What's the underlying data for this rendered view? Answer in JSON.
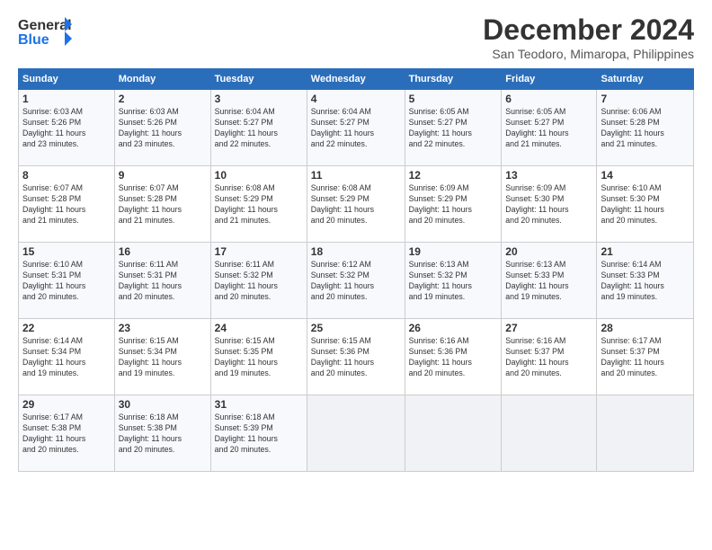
{
  "header": {
    "logo_line1": "General",
    "logo_line2": "Blue",
    "month": "December 2024",
    "location": "San Teodoro, Mimaropa, Philippines"
  },
  "weekdays": [
    "Sunday",
    "Monday",
    "Tuesday",
    "Wednesday",
    "Thursday",
    "Friday",
    "Saturday"
  ],
  "weeks": [
    [
      {
        "day": "1",
        "info": "Sunrise: 6:03 AM\nSunset: 5:26 PM\nDaylight: 11 hours\nand 23 minutes."
      },
      {
        "day": "2",
        "info": "Sunrise: 6:03 AM\nSunset: 5:26 PM\nDaylight: 11 hours\nand 23 minutes."
      },
      {
        "day": "3",
        "info": "Sunrise: 6:04 AM\nSunset: 5:27 PM\nDaylight: 11 hours\nand 22 minutes."
      },
      {
        "day": "4",
        "info": "Sunrise: 6:04 AM\nSunset: 5:27 PM\nDaylight: 11 hours\nand 22 minutes."
      },
      {
        "day": "5",
        "info": "Sunrise: 6:05 AM\nSunset: 5:27 PM\nDaylight: 11 hours\nand 22 minutes."
      },
      {
        "day": "6",
        "info": "Sunrise: 6:05 AM\nSunset: 5:27 PM\nDaylight: 11 hours\nand 21 minutes."
      },
      {
        "day": "7",
        "info": "Sunrise: 6:06 AM\nSunset: 5:28 PM\nDaylight: 11 hours\nand 21 minutes."
      }
    ],
    [
      {
        "day": "8",
        "info": "Sunrise: 6:07 AM\nSunset: 5:28 PM\nDaylight: 11 hours\nand 21 minutes."
      },
      {
        "day": "9",
        "info": "Sunrise: 6:07 AM\nSunset: 5:28 PM\nDaylight: 11 hours\nand 21 minutes."
      },
      {
        "day": "10",
        "info": "Sunrise: 6:08 AM\nSunset: 5:29 PM\nDaylight: 11 hours\nand 21 minutes."
      },
      {
        "day": "11",
        "info": "Sunrise: 6:08 AM\nSunset: 5:29 PM\nDaylight: 11 hours\nand 20 minutes."
      },
      {
        "day": "12",
        "info": "Sunrise: 6:09 AM\nSunset: 5:29 PM\nDaylight: 11 hours\nand 20 minutes."
      },
      {
        "day": "13",
        "info": "Sunrise: 6:09 AM\nSunset: 5:30 PM\nDaylight: 11 hours\nand 20 minutes."
      },
      {
        "day": "14",
        "info": "Sunrise: 6:10 AM\nSunset: 5:30 PM\nDaylight: 11 hours\nand 20 minutes."
      }
    ],
    [
      {
        "day": "15",
        "info": "Sunrise: 6:10 AM\nSunset: 5:31 PM\nDaylight: 11 hours\nand 20 minutes."
      },
      {
        "day": "16",
        "info": "Sunrise: 6:11 AM\nSunset: 5:31 PM\nDaylight: 11 hours\nand 20 minutes."
      },
      {
        "day": "17",
        "info": "Sunrise: 6:11 AM\nSunset: 5:32 PM\nDaylight: 11 hours\nand 20 minutes."
      },
      {
        "day": "18",
        "info": "Sunrise: 6:12 AM\nSunset: 5:32 PM\nDaylight: 11 hours\nand 20 minutes."
      },
      {
        "day": "19",
        "info": "Sunrise: 6:13 AM\nSunset: 5:32 PM\nDaylight: 11 hours\nand 19 minutes."
      },
      {
        "day": "20",
        "info": "Sunrise: 6:13 AM\nSunset: 5:33 PM\nDaylight: 11 hours\nand 19 minutes."
      },
      {
        "day": "21",
        "info": "Sunrise: 6:14 AM\nSunset: 5:33 PM\nDaylight: 11 hours\nand 19 minutes."
      }
    ],
    [
      {
        "day": "22",
        "info": "Sunrise: 6:14 AM\nSunset: 5:34 PM\nDaylight: 11 hours\nand 19 minutes."
      },
      {
        "day": "23",
        "info": "Sunrise: 6:15 AM\nSunset: 5:34 PM\nDaylight: 11 hours\nand 19 minutes."
      },
      {
        "day": "24",
        "info": "Sunrise: 6:15 AM\nSunset: 5:35 PM\nDaylight: 11 hours\nand 19 minutes."
      },
      {
        "day": "25",
        "info": "Sunrise: 6:15 AM\nSunset: 5:36 PM\nDaylight: 11 hours\nand 20 minutes."
      },
      {
        "day": "26",
        "info": "Sunrise: 6:16 AM\nSunset: 5:36 PM\nDaylight: 11 hours\nand 20 minutes."
      },
      {
        "day": "27",
        "info": "Sunrise: 6:16 AM\nSunset: 5:37 PM\nDaylight: 11 hours\nand 20 minutes."
      },
      {
        "day": "28",
        "info": "Sunrise: 6:17 AM\nSunset: 5:37 PM\nDaylight: 11 hours\nand 20 minutes."
      }
    ],
    [
      {
        "day": "29",
        "info": "Sunrise: 6:17 AM\nSunset: 5:38 PM\nDaylight: 11 hours\nand 20 minutes."
      },
      {
        "day": "30",
        "info": "Sunrise: 6:18 AM\nSunset: 5:38 PM\nDaylight: 11 hours\nand 20 minutes."
      },
      {
        "day": "31",
        "info": "Sunrise: 6:18 AM\nSunset: 5:39 PM\nDaylight: 11 hours\nand 20 minutes."
      },
      {
        "day": "",
        "info": ""
      },
      {
        "day": "",
        "info": ""
      },
      {
        "day": "",
        "info": ""
      },
      {
        "day": "",
        "info": ""
      }
    ]
  ]
}
